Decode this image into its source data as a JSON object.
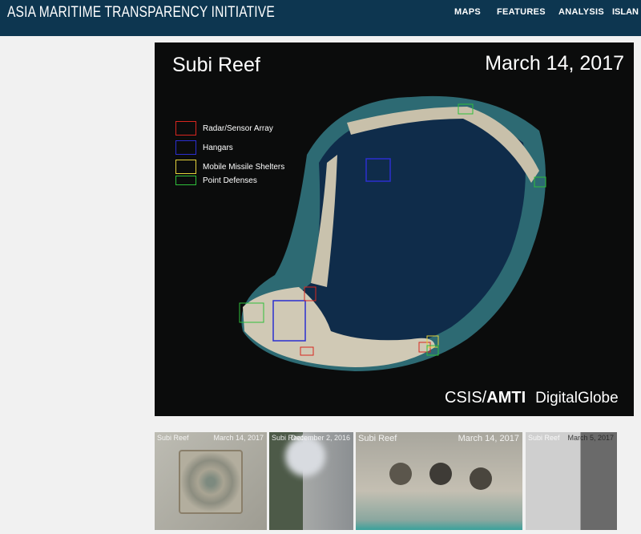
{
  "header": {
    "brand": "ASIA MARITIME TRANSPARENCY INITIATIVE",
    "nav": [
      "MAPS",
      "FEATURES",
      "ANALYSIS",
      "ISLAN"
    ]
  },
  "main_image": {
    "title": "Subi Reef",
    "date": "March 14, 2017",
    "legend": [
      {
        "label": "Radar/Sensor Array",
        "color": "#d8261f"
      },
      {
        "label": "Hangars",
        "color": "#2b2fd0"
      },
      {
        "label": "Mobile Missile Shelters",
        "color": "#e4d23a"
      },
      {
        "label": "Point Defenses",
        "color": "#2fbf3b"
      }
    ],
    "credit_csis": "CSIS/",
    "credit_amti": "AMTI",
    "credit_dg": "DigitalGlobe"
  },
  "thumbnails": [
    {
      "title": "Subi Reef",
      "date": "March 14, 2017"
    },
    {
      "title": "Subi Reef",
      "date": "December 2, 2016"
    },
    {
      "title": "Subi Reef",
      "date": "March 14, 2017"
    },
    {
      "title": "Subi Reef",
      "date": "March 5, 2017"
    }
  ]
}
